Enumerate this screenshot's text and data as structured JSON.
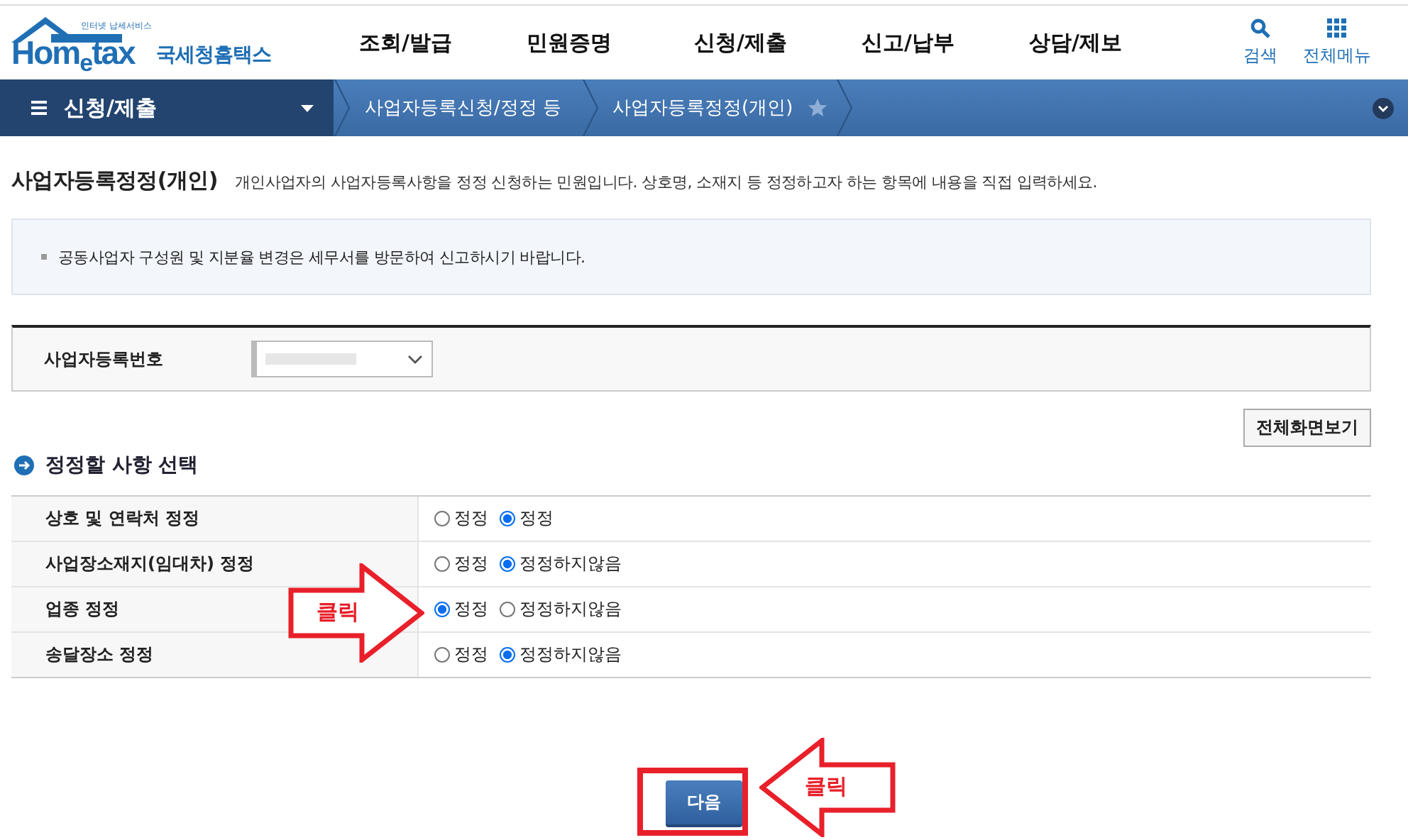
{
  "header": {
    "logo": {
      "tagline": "인터넷 납세서비스",
      "brand_parts": [
        "Hom",
        "e",
        "tax"
      ],
      "agency": "국세청홈택스"
    },
    "nav": [
      "조회/발급",
      "민원증명",
      "신청/제출",
      "신고/납부",
      "상담/제보"
    ],
    "tools": [
      {
        "kind": "search",
        "label": "검색"
      },
      {
        "kind": "grid",
        "label": "전체메뉴"
      }
    ]
  },
  "breadcrumb": {
    "menu": "신청/제출",
    "items": [
      "사업자등록신청/정정 등",
      "사업자등록정정(개인)"
    ]
  },
  "page": {
    "title": "사업자등록정정(개인)",
    "description": "개인사업자의 사업자등록사항을 정정 신청하는 민원입니다. 상호명, 소재지 등 정정하고자 하는 항목에 내용을 직접 입력하세요.",
    "notice": "공동사업자 구성원 및 지분율 변경은 세무서를 방문하여 신고하시기 바랍니다."
  },
  "business_number": {
    "label": "사업자등록번호"
  },
  "fullscreen_button": "전체화면보기",
  "section_title": "정정할 사항 선택",
  "rows": [
    {
      "label": "상호 및 연락처 정정",
      "options": [
        {
          "label": "정정",
          "selected": false
        },
        {
          "label": "정정",
          "selected": true
        }
      ]
    },
    {
      "label": "사업장소재지(임대차) 정정",
      "options": [
        {
          "label": "정정",
          "selected": false
        },
        {
          "label": "정정하지않음",
          "selected": true
        }
      ]
    },
    {
      "label": "업종 정정",
      "options": [
        {
          "label": "정정",
          "selected": true
        },
        {
          "label": "정정하지않음",
          "selected": false
        }
      ]
    },
    {
      "label": "송달장소 정정",
      "options": [
        {
          "label": "정정",
          "selected": false
        },
        {
          "label": "정정하지않음",
          "selected": true
        }
      ]
    }
  ],
  "next_button": "다음",
  "annotations": [
    {
      "kind": "right",
      "label": "클릭"
    },
    {
      "kind": "left",
      "label": "클릭"
    }
  ]
}
